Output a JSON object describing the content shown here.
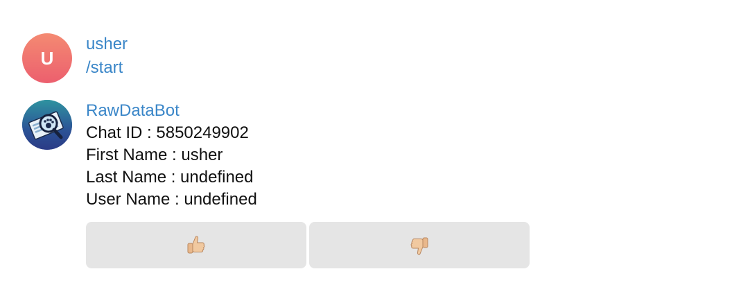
{
  "messages": [
    {
      "avatar_letter": "U",
      "sender": "usher",
      "text": "/start"
    },
    {
      "sender": "RawDataBot",
      "lines": [
        "Chat ID : 5850249902",
        "First Name : usher",
        "Last Name : undefined",
        "User Name : undefined"
      ]
    }
  ],
  "keyboard": {
    "buttons": [
      {
        "icon": "thumbs-up-icon"
      },
      {
        "icon": "thumbs-down-icon"
      }
    ]
  },
  "colors": {
    "sender": "#3a86c8",
    "avatar_user_top": "#f48a72",
    "avatar_user_bottom": "#ec5f6e",
    "button_bg": "#e5e5e5"
  }
}
